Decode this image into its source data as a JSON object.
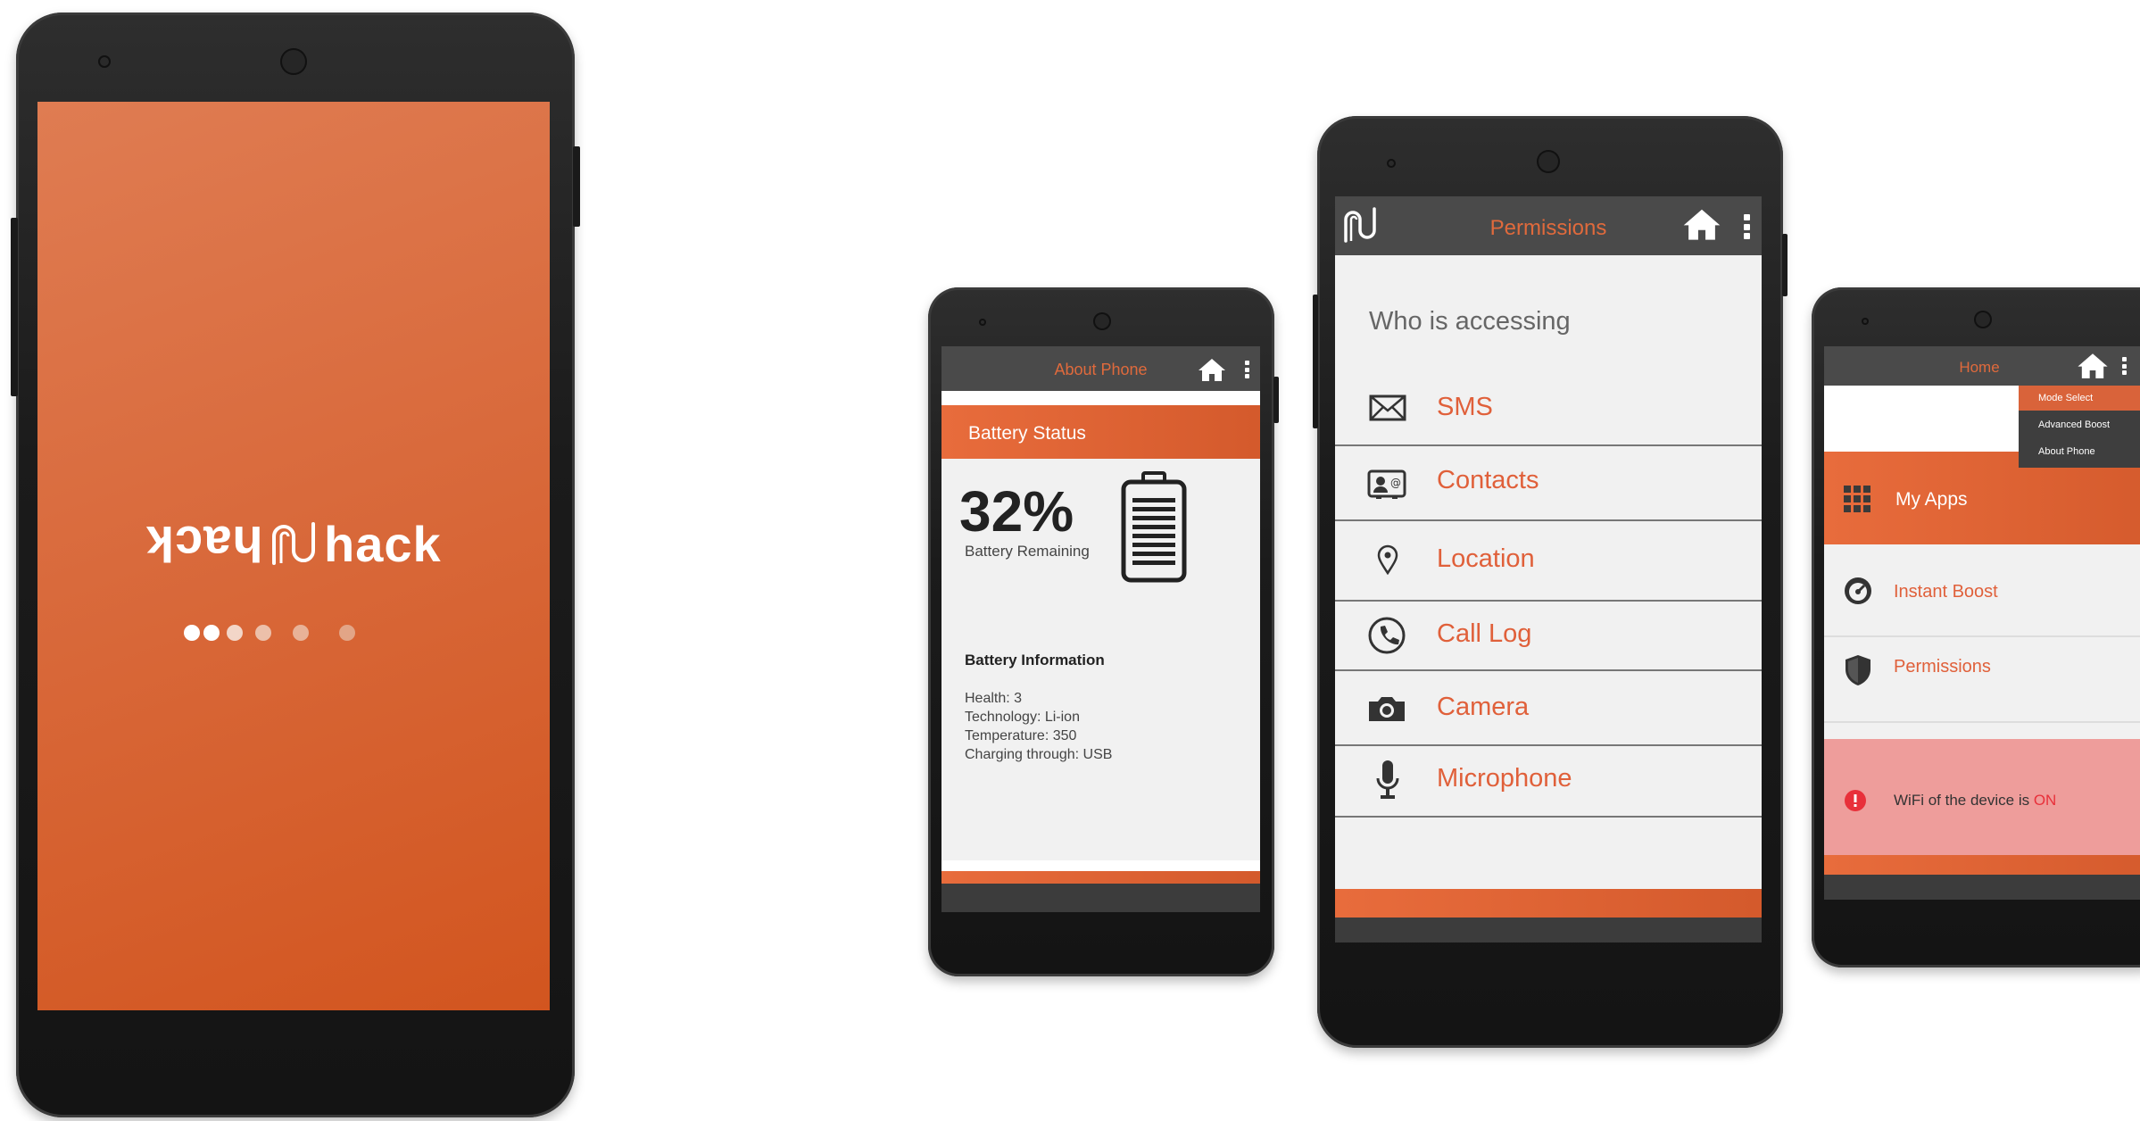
{
  "splash": {
    "logo_mirror": "hack",
    "logo_main": "hack",
    "dots_count": 6
  },
  "about": {
    "title": "About Phone",
    "section_header": "Battery Status",
    "battery_percent": "32%",
    "battery_level": 0.32,
    "battery_caption": "Battery Remaining",
    "info_title": "Battery Information",
    "info_lines": [
      "Health: 3",
      "Technology: Li-ion",
      "Temperature: 350",
      "Charging through: USB"
    ]
  },
  "permissions": {
    "title": "Permissions",
    "heading": "Who is accessing",
    "items": [
      {
        "label": "SMS",
        "icon": "envelope-icon"
      },
      {
        "label": "Contacts",
        "icon": "contact-card-icon"
      },
      {
        "label": "Location",
        "icon": "location-pin-icon"
      },
      {
        "label": "Call Log",
        "icon": "phone-icon"
      },
      {
        "label": "Camera",
        "icon": "camera-icon"
      },
      {
        "label": "Microphone",
        "icon": "microphone-icon"
      }
    ]
  },
  "home": {
    "title": "Home",
    "menu": [
      "Mode Select",
      "Advanced Boost",
      "About Phone"
    ],
    "items": [
      {
        "label": "My Apps",
        "icon": "grid-icon"
      },
      {
        "label": "Instant Boost",
        "icon": "gauge-icon"
      },
      {
        "label": "Permissions",
        "icon": "shield-icon"
      }
    ],
    "alert_text": "WiFi of the device is ",
    "alert_status": "ON"
  },
  "colors": {
    "accent": "#d95f33",
    "appbar": "#4a4a4a",
    "alert_bg": "#ee9d9b",
    "alert_red": "#e8303a"
  }
}
